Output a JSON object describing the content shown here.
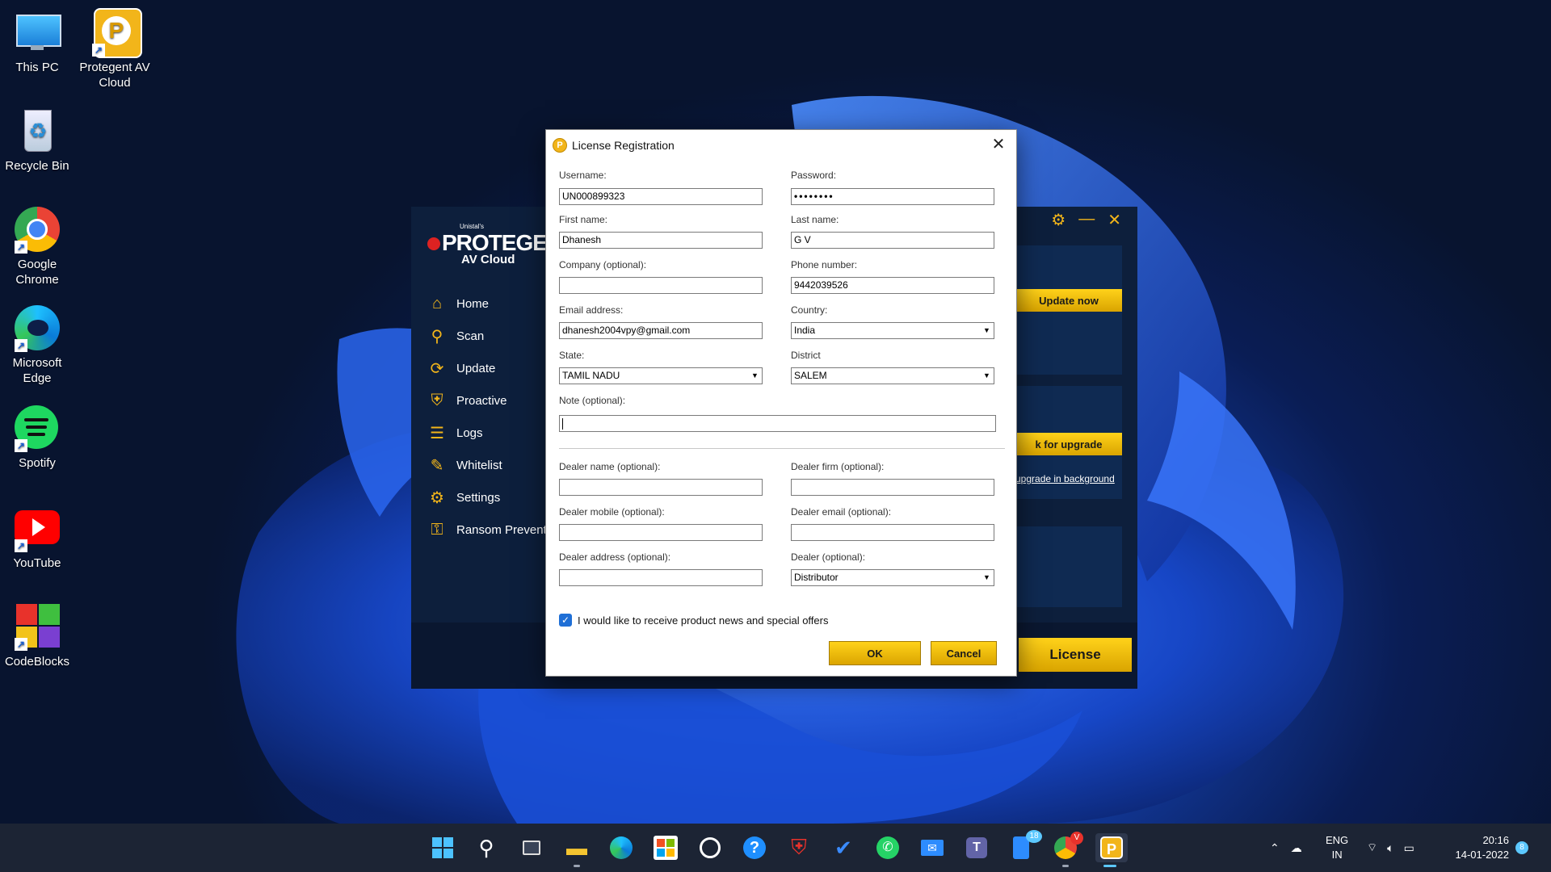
{
  "desktop": {
    "icons": [
      {
        "label": "This PC"
      },
      {
        "label": "Protegent  AV Cloud"
      },
      {
        "label": "Recycle Bin"
      },
      {
        "label": "Google Chrome"
      },
      {
        "label": "Microsoft Edge"
      },
      {
        "label": "Spotify"
      },
      {
        "label": "YouTube"
      },
      {
        "label": "CodeBlocks"
      }
    ]
  },
  "app": {
    "brand_small": "Unistal's",
    "brand": "PROTEGEN",
    "brand_sub": "AV Cloud",
    "nav": [
      {
        "label": "Home",
        "icon": "home-icon"
      },
      {
        "label": "Scan",
        "icon": "scan-icon"
      },
      {
        "label": "Update",
        "icon": "update-icon"
      },
      {
        "label": "Proactive",
        "icon": "proactive-icon"
      },
      {
        "label": "Logs",
        "icon": "logs-icon"
      },
      {
        "label": "Whitelist",
        "icon": "whitelist-icon"
      },
      {
        "label": "Settings",
        "icon": "settings-icon"
      },
      {
        "label": "Ransom Prevent",
        "icon": "ransom-icon"
      }
    ],
    "update_now": "Update now",
    "check_upgrade": "k for upgrade",
    "upgrade_link": "upgrade in background",
    "license": "License",
    "accent": "#f2b51a"
  },
  "dialog": {
    "title": "License Registration",
    "username_label": "Username:",
    "username": "UN000899323",
    "password_label": "Password:",
    "password": "••••••••",
    "first_name_label": "First name:",
    "first_name": "Dhanesh",
    "last_name_label": "Last name:",
    "last_name": "G V",
    "company_label": "Company (optional):",
    "company": "",
    "phone_label": "Phone number:",
    "phone": "9442039526",
    "email_label": "Email address:",
    "email": "dhanesh2004vpy@gmail.com",
    "country_label": "Country:",
    "country": "India",
    "state_label": "State:",
    "state": "TAMIL NADU",
    "district_label": "District",
    "district": "SALEM",
    "note_label": "Note (optional):",
    "note": "",
    "dealer_name_label": "Dealer name (optional):",
    "dealer_firm_label": "Dealer firm (optional):",
    "dealer_mobile_label": "Dealer mobile (optional):",
    "dealer_email_label": "Dealer email (optional):",
    "dealer_address_label": "Dealer address (optional):",
    "dealer_label": "Dealer (optional):",
    "dealer": "Distributor",
    "newsletter_label": "I would like to receive product news and special offers",
    "newsletter_checked": true,
    "ok": "OK",
    "cancel": "Cancel"
  },
  "taskbar": {
    "lang": "ENG",
    "region": "IN",
    "time": "20:16",
    "date": "14-01-2022",
    "teams_badge": "18",
    "notification_badge": "8",
    "chrome_badge": "V"
  }
}
